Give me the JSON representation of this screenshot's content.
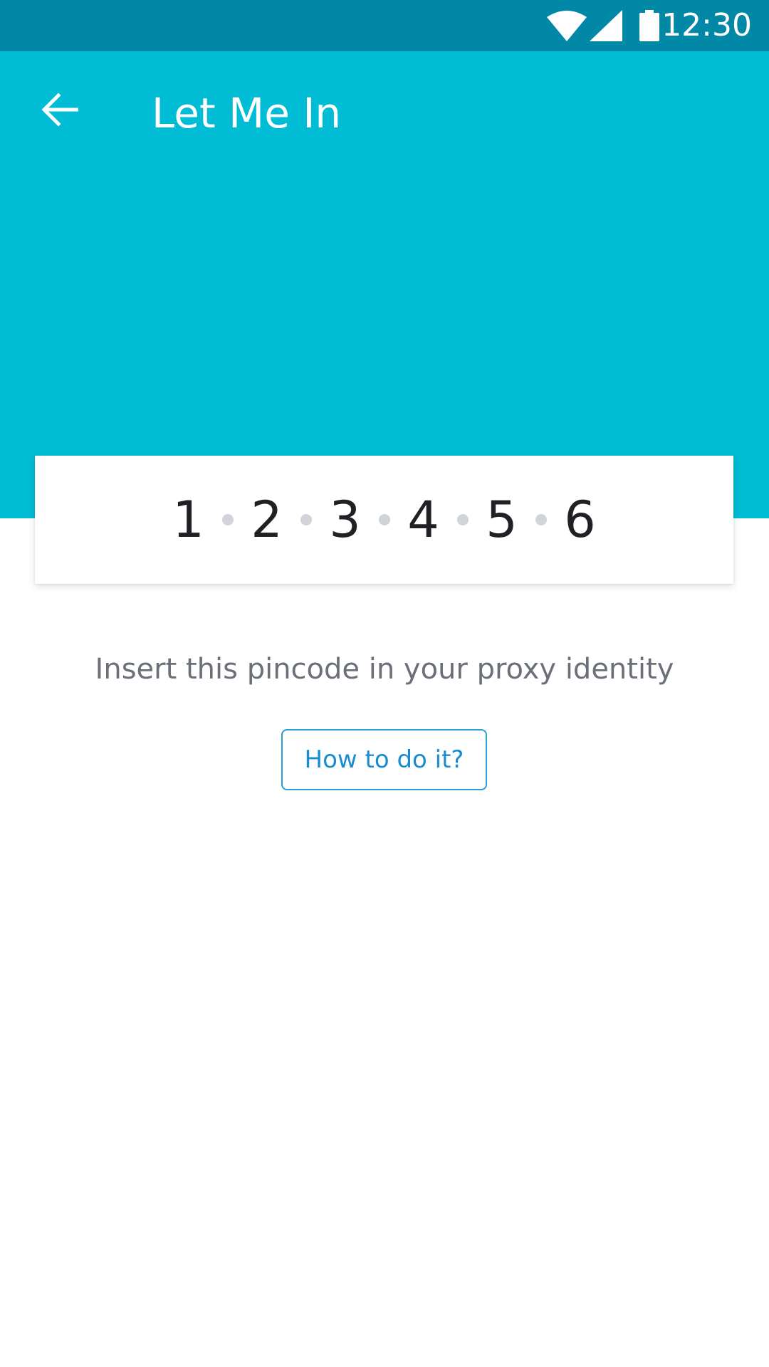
{
  "status_bar": {
    "time": "12:30",
    "icons": [
      "wifi-icon",
      "signal-icon",
      "battery-icon"
    ],
    "background": "#0288A7"
  },
  "app_bar": {
    "title": "Let Me In",
    "back_icon": "arrow-left-icon",
    "background": "#00BCD4"
  },
  "pincode": {
    "digits": [
      "1",
      "2",
      "3",
      "4",
      "5",
      "6"
    ]
  },
  "instruction": "Insert this pincode in your proxy identity",
  "help_button": {
    "label": "How to do it?",
    "color": "#1a8cd0"
  }
}
